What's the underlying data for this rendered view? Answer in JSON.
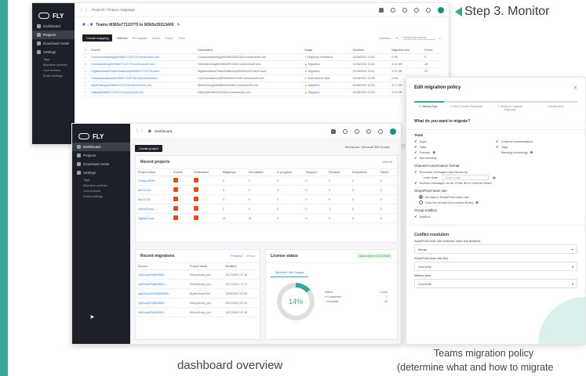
{
  "step_title": "Step 3. Monitor",
  "captions": {
    "dashboard": "dashboard overview",
    "policy_line1": "Teams migration policy",
    "policy_line2": "(determine what and how to migrate"
  },
  "brand": "FLY",
  "back_window": {
    "sidebar": [
      {
        "label": "Dashboard"
      },
      {
        "label": "Projects"
      },
      {
        "label": "Download center"
      },
      {
        "label": "Settings"
      }
    ],
    "settings_sub": [
      "Tags",
      "Migration policies",
      "Connections",
      "Email settings"
    ],
    "breadcrumb": {
      "projects": "Projects",
      "sep": "/",
      "current": "Project mappings"
    },
    "heading": "Teams M365x77110775 to M365x39313400",
    "toolbar": {
      "create": "Create mapping",
      "refresh": "Refresh",
      "r1": "Re-migrate",
      "r2": "Delete",
      "r3": "Export",
      "r4": "More",
      "columns": "Columns",
      "search": "Search by source"
    },
    "columns": [
      "Source",
      "Destination",
      "Stage",
      "Modified",
      "Migrated size",
      "Errors"
    ],
    "rows": [
      {
        "source": "Contosomarketing@M365x77110775.onmicrosoft.com",
        "dest": "Contosomarketing@M365x39313400.onmicrosoft.com",
        "stage": "Mapping verification",
        "status": "ok",
        "modified": "01/06/2022 13:50",
        "size": "0 KB",
        "errors": "0"
      },
      {
        "source": "Xteamstesting@M365x77110775.onmicrosoft.com",
        "dest": "Xteamstesting@M365x39313400.onmicrosoft.com",
        "stage": "Migration",
        "status": "warn",
        "modified": "01/06/2022 13:44",
        "size": "4.32 MB",
        "errors": "18"
      },
      {
        "source": "DigitalInitiativePublicRelations@M365x77110775.onmi",
        "dest": "DigitalInitiativePublicRelations@M365x39313400.onmi",
        "stage": "Migration",
        "status": "warn",
        "modified": "01/06/2022 13:41",
        "size": "3.22 GB",
        "errors": "23"
      },
      {
        "source": "Communications@M365x77110775.onmicrosoft.com",
        "dest": "Communications@M365x39313400.onmicrosoft.com",
        "stage": "Scan source data",
        "status": "ok",
        "modified": "01/06/2022 13:39",
        "size": "0 KB",
        "errors": "0"
      },
      {
        "source": "MarkPricing@M365x77110775.onmicrosoft.com",
        "dest": "MarkPricing@M365x39313400.onmicrosoft.com",
        "stage": "Migration",
        "status": "warn",
        "modified": "01/06/2022 13:33",
        "size": "3.27 GB",
        "errors": "26"
      },
      {
        "source": "Sales@M365x77110775.onmicrosoft.com",
        "dest": "Sales@M365x39313400.onmicrosoft.com",
        "stage": "Migration",
        "status": "warn",
        "modified": "01/06/2022 13:30",
        "size": "3.03 GB",
        "errors": "21"
      }
    ]
  },
  "front_window": {
    "sidebar": [
      {
        "label": "Dashboard"
      },
      {
        "label": "Projects"
      },
      {
        "label": "Download center"
      },
      {
        "label": "Settings"
      }
    ],
    "settings_sub": [
      "Tags",
      "Migration policies",
      "Connections",
      "Email settings"
    ],
    "topbar_title": "Dashboard",
    "create_project": "Create project",
    "workspace": "Workspace: Microsoft 365 Groups",
    "recent_projects": {
      "title": "Recent projects",
      "view_all": "View all",
      "columns": [
        "Project name",
        "Source",
        "Destination",
        "Mappings",
        "Not started",
        "In progress",
        "Stopped",
        "Finished",
        "Exceptions",
        "Failed"
      ],
      "rows": [
        {
          "name": "Groups-8009...",
          "mappings": "2",
          "ns": "2",
          "ip": "0",
          "st": "0",
          "fi": "0",
          "ex": "0",
          "fa": "0"
        },
        {
          "name": "test 12.20",
          "mappings": "0",
          "ns": "0",
          "ip": "0",
          "st": "0",
          "fi": "0",
          "ex": "0",
          "fa": "0"
        },
        {
          "name": "test 12.21",
          "mappings": "0",
          "ns": "0",
          "ip": "0",
          "st": "0",
          "fi": "0",
          "ex": "0",
          "fa": "0"
        },
        {
          "name": "HenryGroup_...",
          "mappings": "1",
          "ns": "0",
          "ip": "0",
          "st": "0",
          "fi": "1",
          "ex": "0",
          "fa": "0"
        },
        {
          "name": "DigitalGroup...",
          "mappings": "11",
          "ns": "11",
          "ip": "0",
          "st": "0",
          "fi": "0",
          "ex": "0",
          "fa": "0"
        }
      ]
    },
    "recent_migrations": {
      "title": "Recent migrations",
      "tab_finished": "Finished",
      "tab_errors": "Errors",
      "columns": [
        "Source",
        "Project name",
        "Modified"
      ],
      "rows": [
        {
          "source": "HyGroupFA@M365x...",
          "project": "HenryGroup_pro",
          "modified": "12/17/2021 17:18"
        },
        {
          "source": "HyGroupFA@M365x...",
          "project": "HenryGroup_pro",
          "modified": "12/17/2021 17:17"
        },
        {
          "source": "AppGroup1202@M365x...",
          "project": "BryanGroupTest",
          "modified": "12/09/2021 22:05"
        },
        {
          "source": "HyGroupFA@M365x...",
          "project": "HenryGroup_pro",
          "modified": "12/17/2021 22:10"
        },
        {
          "source": "HyGroupFA@M365x...",
          "project": "HenryGroup_pro",
          "modified": "12/17/2021 22:18"
        }
      ]
    },
    "license": {
      "title": "License status",
      "expiry": "Date expired: 07/01/2025",
      "tab": "Microsoft 365 Groups",
      "percent": "14%",
      "percent_value": 14,
      "legend_status": "Status",
      "legend_count": "Count",
      "consumed_label": "Consumed",
      "consumed_count": "7",
      "available_label": "Available",
      "available_count": "43"
    }
  },
  "policy": {
    "title": "Edit migration policy",
    "steps": [
      "1. General Type",
      "2. Filter & Conflict Resolution",
      "3. Additional Optional Mappings",
      "4. Notifications"
    ],
    "question": "What do you want to migrate?",
    "team_label": "Team",
    "team_left": [
      "Apps",
      "Tabs",
      "Planner",
      "Membership"
    ],
    "team_right": [
      "Channel conversations",
      "Tags",
      "Meeting recordings"
    ],
    "channel_format": "Channel conversation format",
    "recreate": "Recreate messages and hierarchy",
    "later_than": "Later than",
    "select_date": "Select date",
    "archive": "Archive messages as an HTML file in channel folder",
    "sp_site": "SharePoint team site",
    "sp_all": "All data in SharePoint team site",
    "sp_default": "Only the default Documents library",
    "group_mailbox": "Group mailbox",
    "mailbox": "Mailbox",
    "conflict": "Conflict resolution",
    "cr_site": "SharePoint team site (includes: sites and libraries)",
    "cr_site_val": "Merge",
    "cr_files": "SharePoint team site files",
    "cr_files_val": "Overwrite",
    "cr_mailbox": "Mailbox item",
    "cr_mailbox_val": "Overwrite"
  },
  "colors": {
    "accent": "#3aa79a",
    "sidebar": "#1d2028",
    "o365": "#e34a1b"
  }
}
